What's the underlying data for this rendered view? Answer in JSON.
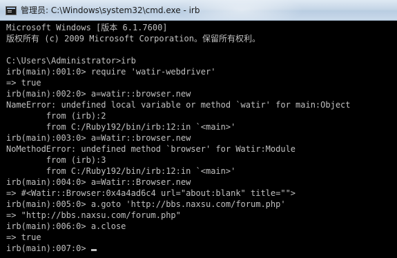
{
  "window": {
    "title": "管理员: C:\\Windows\\system32\\cmd.exe - irb",
    "icon": "cmd-icon"
  },
  "console": {
    "lines": [
      "Microsoft Windows [版本 6.1.7600]",
      "版权所有 (c) 2009 Microsoft Corporation。保留所有权利。",
      "",
      "C:\\Users\\Administrator>irb",
      "irb(main):001:0> require 'watir-webdriver'",
      "=> true",
      "irb(main):002:0> a=watir::browser.new",
      "NameError: undefined local variable or method `watir' for main:Object",
      "        from (irb):2",
      "        from C:/Ruby192/bin/irb:12:in `<main>'",
      "irb(main):003:0> a=Watir::browser.new",
      "NoMethodError: undefined method `browser' for Watir:Module",
      "        from (irb):3",
      "        from C:/Ruby192/bin/irb:12:in `<main>'",
      "irb(main):004:0> a=Watir::Browser.new",
      "=> #<Watir::Browser:0x4a4ad6c4 url=\"about:blank\" title=\"\">",
      "irb(main):005:0> a.goto 'http://bbs.naxsu.com/forum.php'",
      "=> \"http://bbs.naxsu.com/forum.php\"",
      "irb(main):006:0> a.close",
      "=> true",
      "irb(main):007:0> "
    ]
  },
  "colors": {
    "background": "#000000",
    "text": "#c0c0c0"
  }
}
